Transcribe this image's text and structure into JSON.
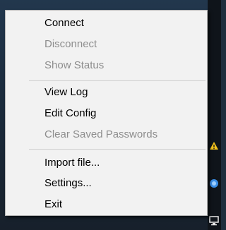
{
  "context_menu": {
    "items": [
      {
        "label": "Connect",
        "enabled": true
      },
      {
        "label": "Disconnect",
        "enabled": false
      },
      {
        "label": "Show Status",
        "enabled": false
      },
      {
        "label": "View Log",
        "enabled": true
      },
      {
        "label": "Edit Config",
        "enabled": true
      },
      {
        "label": "Clear Saved Passwords",
        "enabled": false
      },
      {
        "label": "Import file...",
        "enabled": true
      },
      {
        "label": "Settings...",
        "enabled": true
      },
      {
        "label": "Exit",
        "enabled": true
      }
    ]
  },
  "tray": {
    "icons": [
      "warning-shield-icon",
      "blue-app-icon",
      "network-icon"
    ]
  },
  "colors": {
    "menu_background": "#f2f2f2",
    "enabled_text": "#000000",
    "disabled_text": "#8d8d8d",
    "separator": "#cfcfcf"
  }
}
